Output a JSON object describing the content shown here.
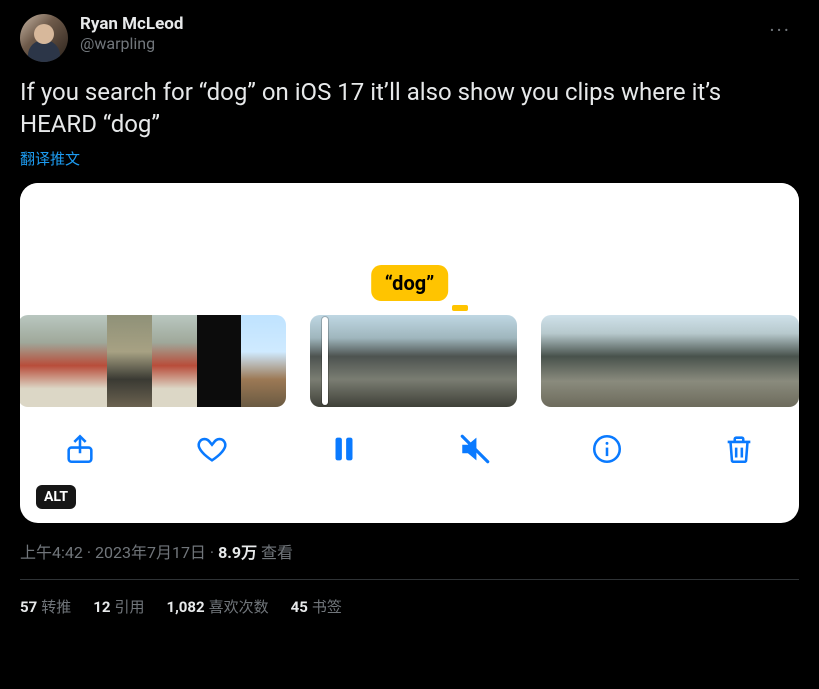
{
  "author": {
    "name": "Ryan McLeod",
    "handle": "@warpling"
  },
  "more_label": "···",
  "text": "If you search for “dog” on iOS 17 it’ll also show you clips where it’s HEARD “dog”",
  "translate": "翻译推文",
  "media": {
    "bubble": "“dog”",
    "alt_badge": "ALT",
    "toolbar": [
      "share",
      "like",
      "pause",
      "mute",
      "info",
      "trash"
    ]
  },
  "meta": {
    "time": "上午4:42",
    "date": "2023年7月17日",
    "views_n": "8.9万",
    "views_label": "查看",
    "sep": " · "
  },
  "stats": {
    "retweets_n": "57",
    "retweets_l": "转推",
    "quotes_n": "12",
    "quotes_l": "引用",
    "likes_n": "1,082",
    "likes_l": "喜欢次数",
    "bookmarks_n": "45",
    "bookmarks_l": "书签"
  }
}
